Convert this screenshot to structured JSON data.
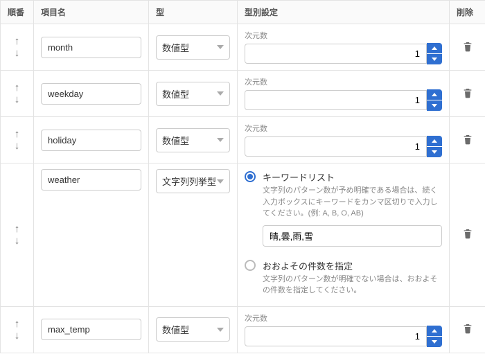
{
  "headers": {
    "order": "順番",
    "name": "項目名",
    "type": "型",
    "config": "型別設定",
    "delete": "削除"
  },
  "dim_label": "次元数",
  "rows": [
    {
      "name": "month",
      "type": "数値型",
      "dim": "1"
    },
    {
      "name": "weekday",
      "type": "数値型",
      "dim": "1"
    },
    {
      "name": "holiday",
      "type": "数値型",
      "dim": "1"
    },
    {
      "name": "weather",
      "type": "文字列列挙型",
      "keywords": "晴,曇,雨,雪"
    },
    {
      "name": "max_temp",
      "type": "数値型",
      "dim": "1"
    }
  ],
  "enum_options": {
    "opt1_title": "キーワードリスト",
    "opt1_desc": "文字列のパターン数が予め明確である場合は、続く入力ボックスにキーワードをカンマ区切りで入力してください。(例: A, B, O, AB)",
    "opt2_title": "おおよその件数を指定",
    "opt2_desc": "文字列のパターン数が明確でない場合は、おおよその件数を指定してください。"
  }
}
